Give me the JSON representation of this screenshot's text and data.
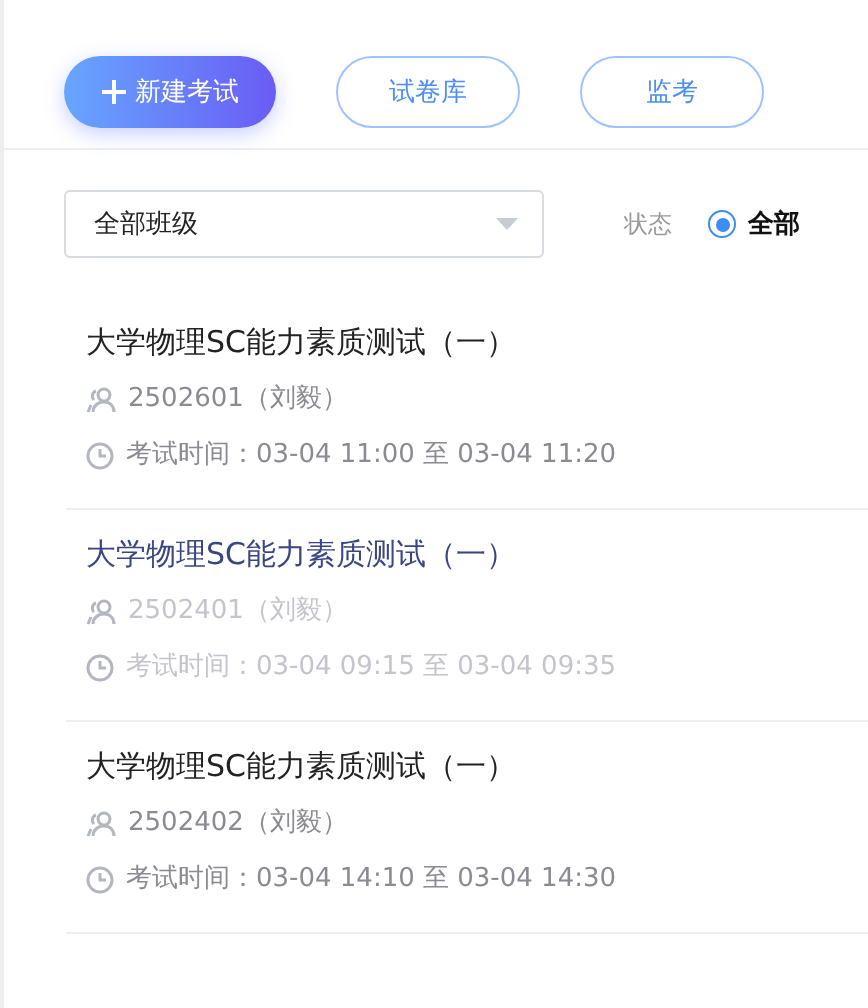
{
  "toolbar": {
    "buttons": [
      {
        "label": "新建考试",
        "kind": "primary"
      },
      {
        "label": "试卷库",
        "kind": "outline"
      },
      {
        "label": "监考",
        "kind": "outline"
      }
    ]
  },
  "filters": {
    "class_select": {
      "value": "全部班级"
    },
    "status_label": "状态",
    "status_options": [
      {
        "label": "全部",
        "selected": true
      }
    ]
  },
  "exams": [
    {
      "title": "大学物理SC能力素质测试（一）",
      "class": "2502601（刘毅）",
      "time": "考试时间：03-04 11:00 至 03-04 11:20",
      "dimmed": false
    },
    {
      "title": "大学物理SC能力素质测试（一）",
      "class": "2502401（刘毅）",
      "time": "考试时间：03-04 09:15 至 03-04 09:35",
      "dimmed": true
    },
    {
      "title": "大学物理SC能力素质测试（一）",
      "class": "2502402（刘毅）",
      "time": "考试时间：03-04 14:10 至 03-04 14:30",
      "dimmed": false
    }
  ]
}
